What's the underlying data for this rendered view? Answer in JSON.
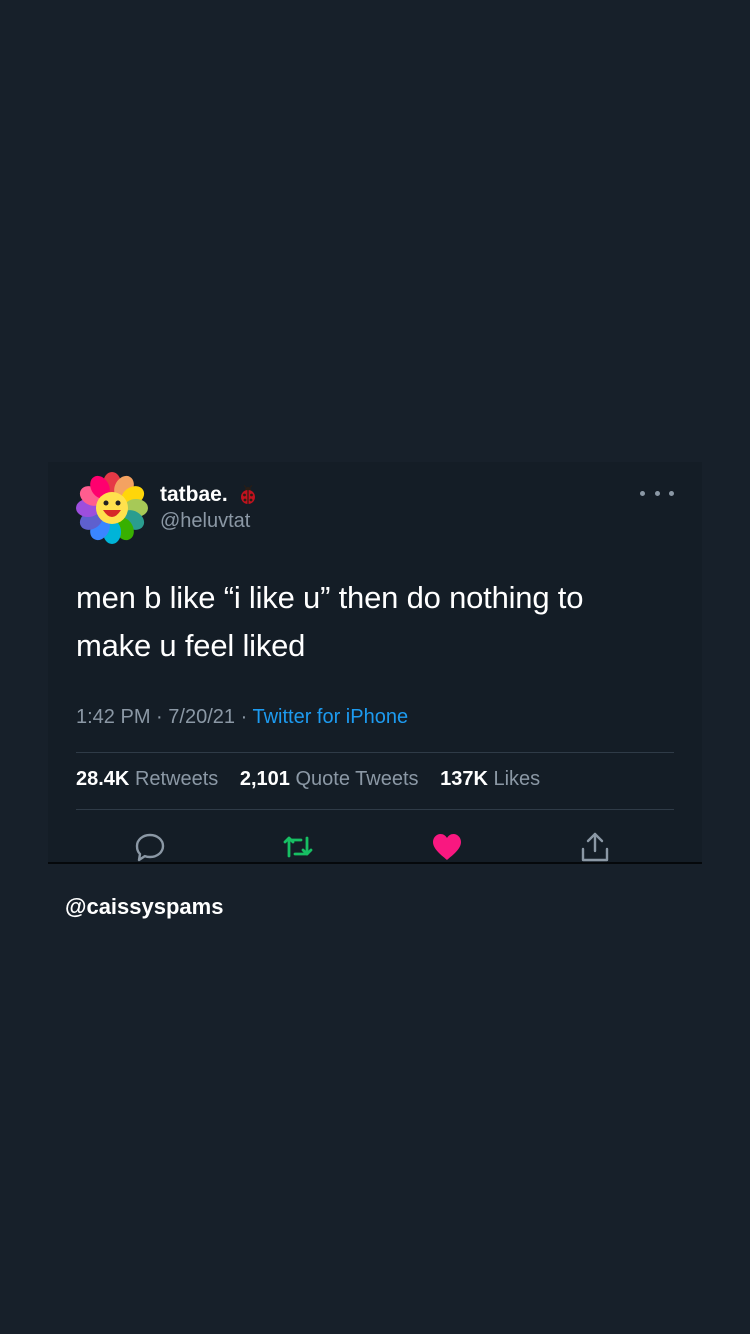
{
  "tweet": {
    "display_name": "tatbae.",
    "name_emoji": "ladybug-icon",
    "handle": "@heluvtat",
    "avatar": "rainbow-flower-icon",
    "text": "men b like “i like u” then do nothing to make u feel liked",
    "time": "1:42 PM",
    "date": "7/20/21",
    "separator": "·",
    "source": "Twitter for iPhone",
    "stats": {
      "retweets_count": "28.4K",
      "retweets_label": "Retweets",
      "quotes_count": "2,101",
      "quotes_label": "Quote Tweets",
      "likes_count": "137K",
      "likes_label": "Likes"
    },
    "actions": [
      "reply-icon",
      "retweet-icon",
      "like-icon",
      "share-icon"
    ]
  },
  "watermark": "@caissyspams",
  "colors": {
    "background": "#17202a",
    "card": "#141d26",
    "accent_link": "#1d9bf0",
    "retweet": "#17bf63",
    "like": "#f91880",
    "secondary_text": "#8b98a5"
  }
}
